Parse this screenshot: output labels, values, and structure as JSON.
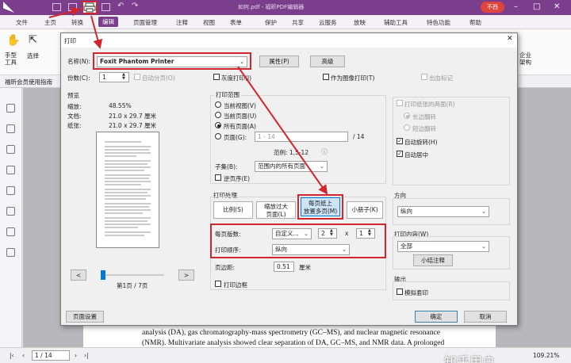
{
  "app": {
    "window_title": "如何.pdf - 福昕PDF编辑器",
    "signin": "不西",
    "menus": [
      "文件",
      "主页",
      "转换",
      "编辑",
      "页面管理",
      "注释",
      "视图",
      "表单",
      "保护",
      "共享",
      "云服务",
      "放映",
      "辅助工具",
      "特色功能",
      "帮助"
    ],
    "active_menu": "编辑",
    "ribbon": {
      "hand_tool": "手型\n工具",
      "select": "选择",
      "enterprise": "企业\n架构"
    },
    "doc_tab": "福昕会员使用指南"
  },
  "document": {
    "line1": "analysis (DA), gas chromatography-mass spectrometry (GC–MS), and nuclear magnetic resonance",
    "line2": "(NMR). Multivariate analysis showed clear separation of DA, GC–MS, and NMR data. A prolonged"
  },
  "status": {
    "page": "1 / 14",
    "zoom": "109.21%",
    "watermark": "知乎用户"
  },
  "dialog": {
    "title": "打印",
    "printer_label": "名称(N):",
    "printer_value": "Foxit Phantom Printer",
    "properties_btn": "属性(P)",
    "advanced_btn": "高级",
    "copies_label": "份数(C):",
    "copies_value": "1",
    "collate": "自动分页(O)",
    "grayscale": "灰度打印(I)",
    "print_as_image": "作为图像打印(T)",
    "print_marks": "出血标记",
    "preview": {
      "title": "预览",
      "zoom_label": "缩放:",
      "zoom_value": "48.55%",
      "doc_label": "文档:",
      "doc_value": "21.0 x 29.7 厘米",
      "paper_label": "纸张:",
      "paper_value": "21.0 x 29.7 厘米",
      "page_indicator": "第1页 / 7页",
      "prev": "<",
      "next": ">"
    },
    "range": {
      "title": "打印范围",
      "current_view": "当前视图(V)",
      "current_page": "当前页面(U)",
      "all_pages": "所有页面(A)",
      "pages": "页面(G):",
      "pages_value": "1 - 14",
      "pages_total": "/ 14",
      "example": "范例: 1,5-12",
      "subset_label": "子集(B):",
      "subset_value": "范围内的所有页面",
      "reverse": "逆页序(E)"
    },
    "options": {
      "both_sides": "打印纸张的两面(R)",
      "long_edge": "长边翻转",
      "short_edge": "短边翻转",
      "auto_rotate": "自动旋转(H)",
      "auto_center": "自动居中"
    },
    "handling": {
      "title": "打印处理",
      "tabs": [
        "比例(S)",
        "缩放过大\n页面(L)",
        "每页纸上\n放置多页(M)",
        "小册子(K)"
      ],
      "active_tab": 2,
      "pages_per_sheet_label": "每页版数:",
      "pages_per_sheet_value": "自定义...",
      "cols": "2",
      "times": "x",
      "rows": "1",
      "order_label": "打印顺序:",
      "order_value": "纵向",
      "margin_label": "页边距:",
      "margin_value": "0.51",
      "margin_unit": "厘米",
      "print_border": "打印边框"
    },
    "orientation": {
      "title": "方向",
      "value": "纵向"
    },
    "content": {
      "title": "打印内容(W)",
      "value": "全部",
      "summarize": "小结注释"
    },
    "output": {
      "title": "输出",
      "simulate": "模拟套印"
    },
    "page_setup": "页面设置",
    "ok": "确定",
    "cancel": "取消"
  },
  "colors": {
    "accent": "#7a3e8c",
    "highlight": "#d2262f",
    "selected_tab": "#cce4f7"
  }
}
